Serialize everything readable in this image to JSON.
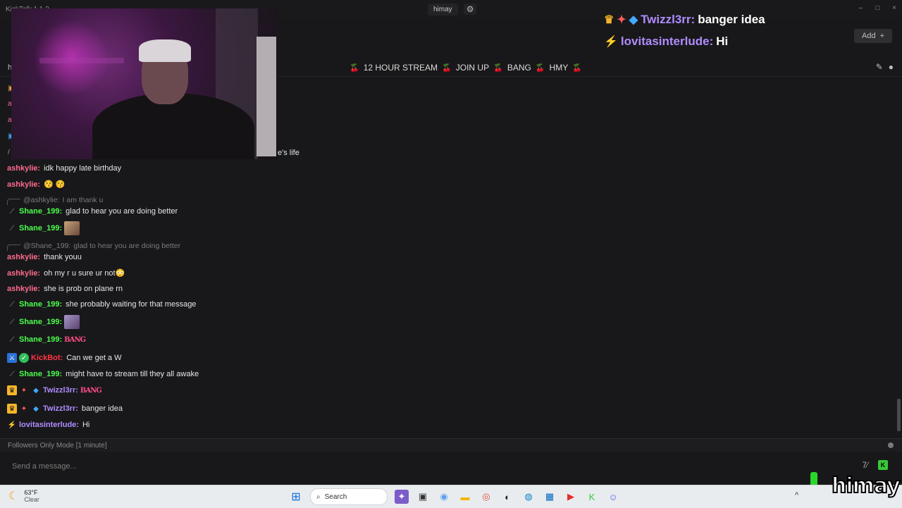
{
  "window": {
    "app_title": "KickTalk 1.1.2",
    "channel_tab": "himay",
    "controls": [
      "–",
      "□",
      "×"
    ]
  },
  "overlay_chat": [
    {
      "username": "Twizzl3rr:",
      "message": "banger idea"
    },
    {
      "username": "lovitasinterlude:",
      "message": "Hi"
    }
  ],
  "add_button": {
    "label": "Add",
    "icon": "plus-icon"
  },
  "tab_row": {
    "left_label": "h"
  },
  "stream_title": {
    "parts": [
      "12 HOUR STREAM",
      "JOIN UP",
      "BANG",
      "HMY"
    ]
  },
  "cropped_message_tail": "e's life",
  "chat": {
    "messages": [
      {
        "kind": "msg",
        "user": "ashkylie:",
        "text": "idk happy late birthday"
      },
      {
        "kind": "msg",
        "user": "ashkylie:",
        "text": "😚 😚"
      },
      {
        "kind": "reply",
        "user": "@ashkylie:",
        "text": "I am thank u"
      },
      {
        "kind": "msg",
        "user": "Shane_199:",
        "text": "glad to hear you are doing better"
      },
      {
        "kind": "msg",
        "user": "Shane_199:",
        "text": ""
      },
      {
        "kind": "reply",
        "user": "@Shane_199:",
        "text": "glad to hear you are doing better"
      },
      {
        "kind": "msg",
        "user": "ashkylie:",
        "text": "thank youu"
      },
      {
        "kind": "msg",
        "user": "ashkylie:",
        "text": "oh my r u sure ur not😳"
      },
      {
        "kind": "msg",
        "user": "ashkylie:",
        "text": "she is prob on plane rn"
      },
      {
        "kind": "msg",
        "user": "Shane_199:",
        "text": "she probably waiting for that message"
      },
      {
        "kind": "msg",
        "user": "Shane_199:",
        "text": ""
      },
      {
        "kind": "msg",
        "user": "Shane_199:",
        "text": "BANG"
      },
      {
        "kind": "msg",
        "user": "KickBot:",
        "text": "Can we get a W"
      },
      {
        "kind": "msg",
        "user": "Shane_199:",
        "text": "might have to stream till they all awake"
      },
      {
        "kind": "msg",
        "user": "Twizzl3rr:",
        "text": "BANG"
      },
      {
        "kind": "msg",
        "user": "Twizzl3rr:",
        "text": "banger idea"
      },
      {
        "kind": "msg",
        "user": "lovitasinterlude:",
        "text": "Hi"
      }
    ]
  },
  "mode_bar": {
    "text": "Followers Only Mode [1 minute]"
  },
  "input": {
    "placeholder": "Send a message..."
  },
  "taskbar": {
    "weather_temp": "63°F",
    "weather_desc": "Clear",
    "search_label": "Search"
  },
  "streamer_logo": "himay"
}
